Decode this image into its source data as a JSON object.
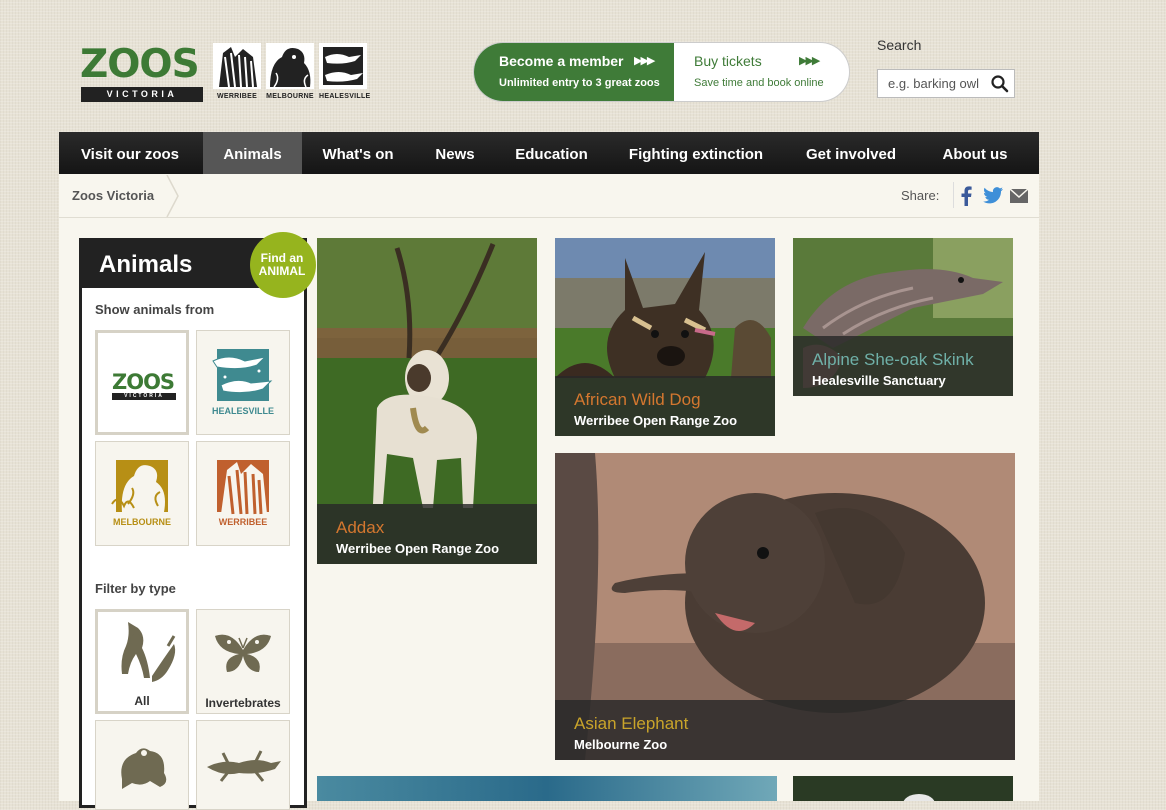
{
  "logo": {
    "brand": "ZOOS",
    "tagline": "VICTORIA",
    "zoos": [
      "WERRIBEE",
      "MELBOURNE",
      "HEALESVILLE"
    ]
  },
  "cta": {
    "member_title": "Become a member",
    "member_sub": "Unlimited entry to 3 great zoos",
    "tickets_title": "Buy tickets",
    "tickets_sub": "Save time and book online"
  },
  "search": {
    "label": "Search",
    "placeholder": "e.g. barking owl"
  },
  "nav": {
    "items": [
      "Visit our zoos",
      "Animals",
      "What's on",
      "News",
      "Education",
      "Fighting extinction",
      "Get involved",
      "About us"
    ],
    "active": "Animals"
  },
  "breadcrumb": {
    "home": "Zoos Victoria"
  },
  "share": {
    "label": "Share:"
  },
  "sidebar": {
    "title": "Animals",
    "badge_line1": "Find an",
    "badge_line2": "ANIMAL",
    "show_from_label": "Show animals from",
    "zoo_filters": [
      "ZOOS VICTORIA",
      "HEALESVILLE",
      "MELBOURNE",
      "WERRIBEE"
    ],
    "filter_type_label": "Filter by type",
    "type_filters": [
      "All",
      "Invertebrates"
    ]
  },
  "animals": [
    {
      "name": "Addax",
      "zoo": "Werribee Open Range Zoo",
      "color": "#d4772f"
    },
    {
      "name": "African Wild Dog",
      "zoo": "Werribee Open Range Zoo",
      "color": "#d4772f"
    },
    {
      "name": "Alpine She-oak Skink",
      "zoo": "Healesville Sanctuary",
      "color": "#6fb0a8"
    },
    {
      "name": "Asian Elephant",
      "zoo": "Melbourne Zoo",
      "color": "#c9a42a"
    }
  ]
}
